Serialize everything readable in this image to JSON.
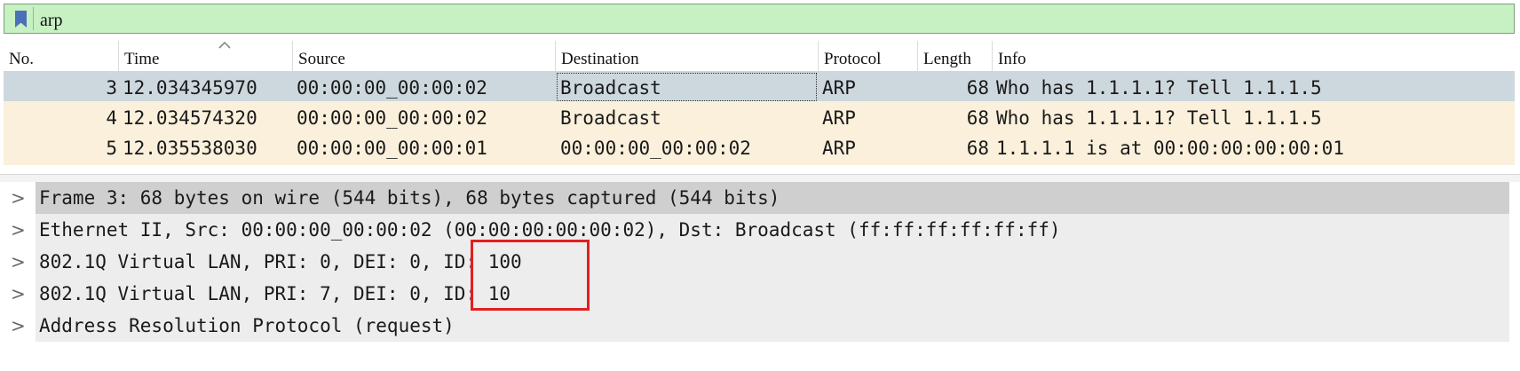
{
  "filter": {
    "text": "arp",
    "icon": "bookmark-icon"
  },
  "columns": {
    "no": "No.",
    "time": "Time",
    "source": "Source",
    "destination": "Destination",
    "protocol": "Protocol",
    "length": "Length",
    "info": "Info"
  },
  "packets": [
    {
      "no": "3",
      "time": "12.034345970",
      "source": "00:00:00_00:00:02",
      "destination": "Broadcast",
      "protocol": "ARP",
      "length": "68",
      "info": "Who has 1.1.1.1? Tell 1.1.1.5"
    },
    {
      "no": "4",
      "time": "12.034574320",
      "source": "00:00:00_00:00:02",
      "destination": "Broadcast",
      "protocol": "ARP",
      "length": "68",
      "info": "Who has 1.1.1.1? Tell 1.1.1.5"
    },
    {
      "no": "5",
      "time": "12.035538030",
      "source": "00:00:00_00:00:01",
      "destination": "00:00:00_00:00:02",
      "protocol": "ARP",
      "length": "68",
      "info": "1.1.1.1 is at 00:00:00:00:00:01"
    }
  ],
  "details": [
    "Frame 3: 68 bytes on wire (544 bits), 68 bytes captured (544 bits)",
    "Ethernet II, Src: 00:00:00_00:00:02 (00:00:00:00:00:02), Dst: Broadcast (ff:ff:ff:ff:ff:ff)",
    "802.1Q Virtual LAN, PRI: 0, DEI: 0, ID: 100",
    "802.1Q Virtual LAN, PRI: 7, DEI: 0, ID: 10",
    "Address Resolution Protocol (request)"
  ],
  "tree_arrow": ">",
  "colors": {
    "filter_bg": "#c7f0c3",
    "selected_row": "#cdd8de",
    "arp_row": "#faf0db",
    "highlight": "#e02020"
  }
}
